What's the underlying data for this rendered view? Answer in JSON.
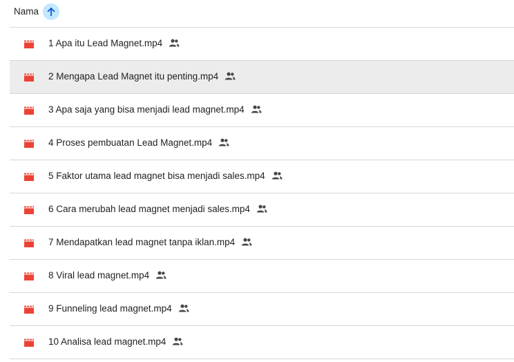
{
  "header": {
    "column_label": "Nama",
    "sort_icon": "arrow-up-icon",
    "sort_active_color": "#c2e7ff"
  },
  "files": {
    "file_icon": "video-file-icon",
    "file_icon_color": "#ea4335",
    "shared_icon": "shared-people-icon",
    "selected_index": 1,
    "items": [
      {
        "name": "1 Apa itu Lead Magnet.mp4"
      },
      {
        "name": "2 Mengapa Lead Magnet itu penting.mp4"
      },
      {
        "name": "3 Apa saja yang bisa menjadi lead magnet.mp4"
      },
      {
        "name": "4 Proses pembuatan Lead Magnet.mp4"
      },
      {
        "name": "5 Faktor utama lead magnet bisa menjadi sales.mp4"
      },
      {
        "name": "6 Cara merubah lead magnet menjadi sales.mp4"
      },
      {
        "name": "7 Mendapatkan lead magnet tanpa iklan.mp4"
      },
      {
        "name": "8 Viral lead magnet.mp4"
      },
      {
        "name": "9 Funneling lead magnet.mp4"
      },
      {
        "name": "10 Analisa lead magnet.mp4"
      }
    ]
  }
}
